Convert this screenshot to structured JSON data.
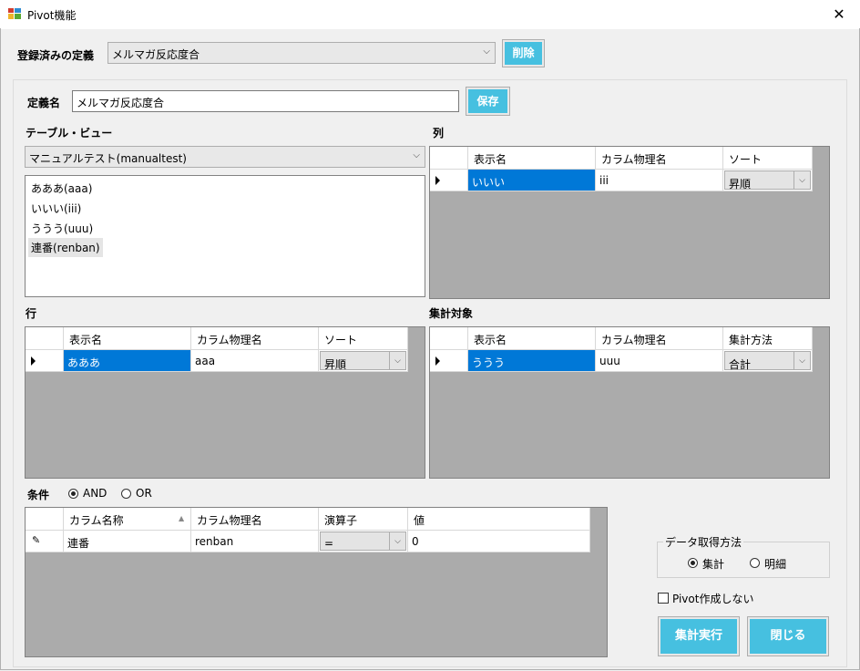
{
  "window": {
    "title": "Pivot機能",
    "close_glyph": "✕",
    "icon": "app-window-icon"
  },
  "registered": {
    "label": "登録済みの定義",
    "selected": "メルマガ反応度合",
    "delete_label": "削除"
  },
  "definition": {
    "label": "定義名",
    "value": "メルマガ反応度合",
    "save_label": "保存"
  },
  "table_view": {
    "label": "テーブル・ビュー",
    "selected": "マニュアルテスト(manualtest)",
    "items": [
      "あああ(aaa)",
      "いいい(iii)",
      "ううう(uuu)",
      "連番(renban)"
    ]
  },
  "columns_grid": {
    "label": "列",
    "headers": [
      "表示名",
      "カラム物理名",
      "ソート"
    ],
    "rows": [
      {
        "display": "いいい",
        "physical": "iii",
        "sort": "昇順"
      }
    ]
  },
  "rows_grid": {
    "label": "行",
    "headers": [
      "表示名",
      "カラム物理名",
      "ソート"
    ],
    "rows": [
      {
        "display": "あああ",
        "physical": "aaa",
        "sort": "昇順"
      }
    ]
  },
  "aggregate_grid": {
    "label": "集計対象",
    "headers": [
      "表示名",
      "カラム物理名",
      "集計方法"
    ],
    "rows": [
      {
        "display": "ううう",
        "physical": "uuu",
        "method": "合計"
      }
    ]
  },
  "conditions": {
    "label": "条件",
    "and_label": "AND",
    "or_label": "OR",
    "and_selected": true,
    "headers": [
      "カラム名称",
      "カラム物理名",
      "演算子",
      "値"
    ],
    "rows": [
      {
        "name": "連番",
        "physical": "renban",
        "operator": "=",
        "value": "0"
      }
    ]
  },
  "data_method": {
    "label": "データ取得方法",
    "aggregate_label": "集計",
    "detail_label": "明細",
    "aggregate_selected": true
  },
  "no_pivot_label": "Pivot作成しない",
  "run_label": "集計実行",
  "close_label": "閉じる",
  "colors": {
    "accent": "#46c0e0",
    "selection": "#0078d7",
    "grid_bg": "#ababab"
  }
}
